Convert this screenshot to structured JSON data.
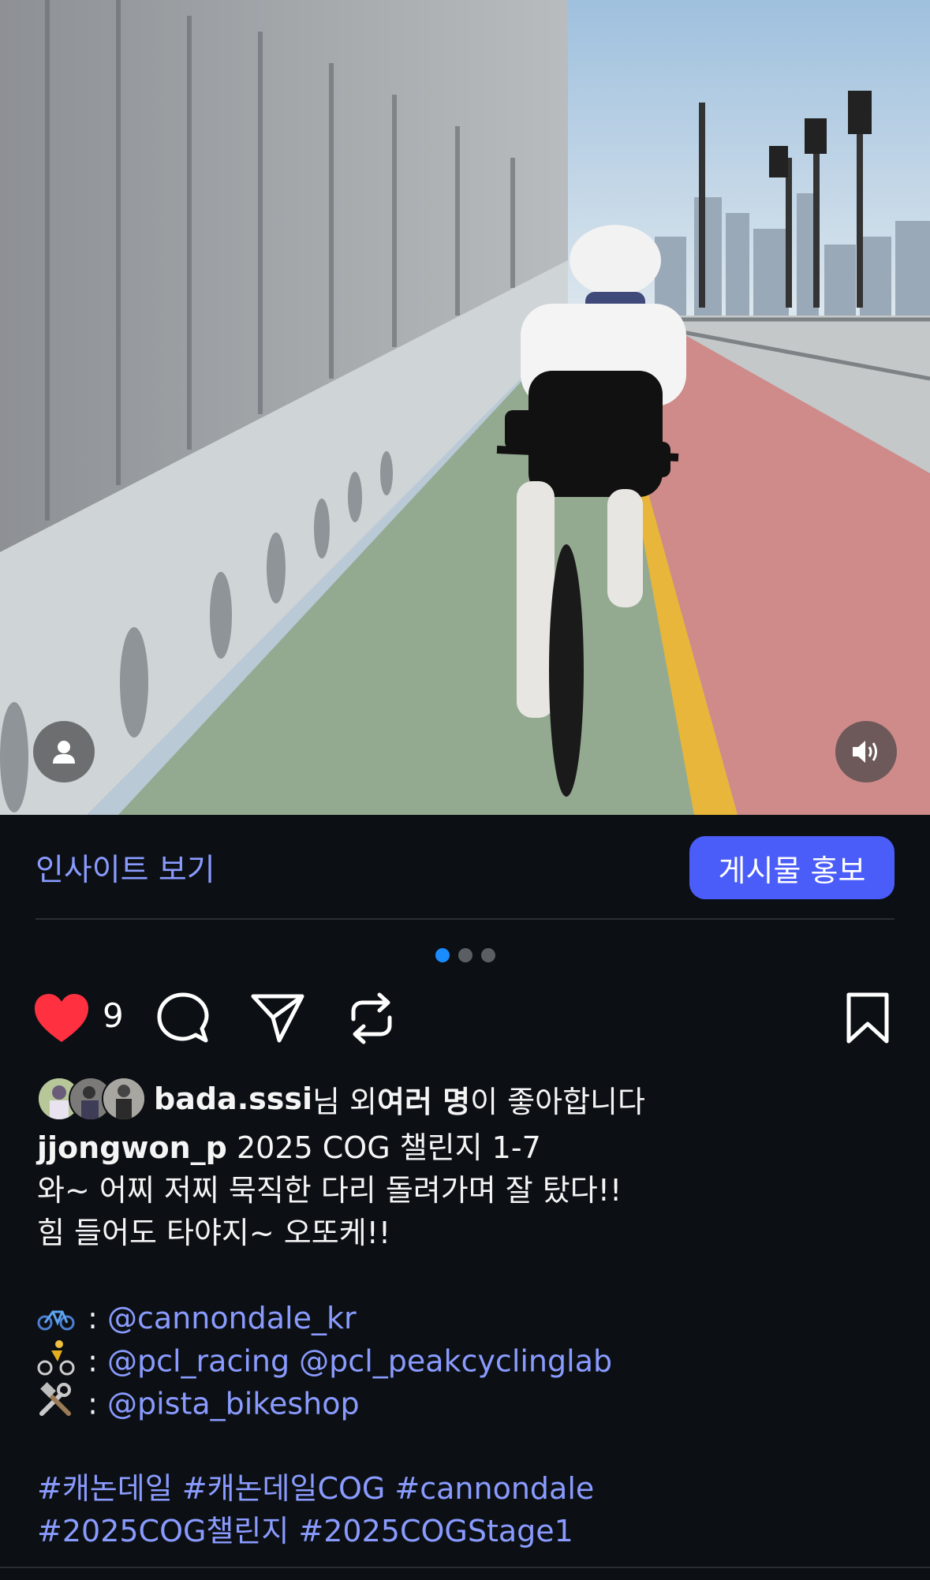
{
  "post": {
    "insights_label": "인사이트 보기",
    "boost_label": "게시물 홍보",
    "carousel": {
      "count": 3,
      "active": 0
    },
    "like_count": "9",
    "liked_by": {
      "user": "bada.sssi",
      "suffix_1": "님 외 ",
      "others": "여러 명",
      "suffix_2": "이 좋아합니다"
    },
    "caption": {
      "username": "jjongwon_p",
      "title": " 2025 COG 챌린지 1-7",
      "line2": "와~ 어찌 저찌 묵직한 다리 돌려가며 잘 탔다!!",
      "line3": "힘 들어도 타야지~ 오또케!!",
      "credits": [
        {
          "icon": "bicycle-icon",
          "sep": " : ",
          "mentions": "@cannondale_kr"
        },
        {
          "icon": "cyclist-icon",
          "sep": " : ",
          "mentions": "@pcl_racing @pcl_peakcyclinglab"
        },
        {
          "icon": "tools-icon",
          "sep": " : ",
          "mentions": "@pista_bikeshop"
        }
      ],
      "hashtags_1": "#캐논데일 #캐논데일COG #cannondale",
      "hashtags_2": "#2025COG챌린지 #2025COGStage1"
    }
  },
  "colors": {
    "background": "#0c1014",
    "link": "#8a9bff",
    "boost_button": "#4a5df9",
    "like_heart": "#ff3040",
    "active_dot": "#1a8cff"
  }
}
